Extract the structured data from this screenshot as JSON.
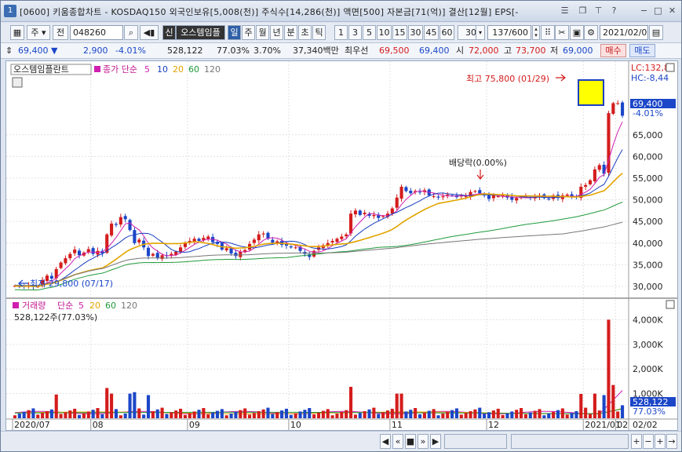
{
  "window": {
    "badge": "1",
    "title": "[0600] 키움종합차트 - KOSDAQ150 외국인보유[5,008(천)] 주식수[14,286(천)] 액면[500] 자본금[71(억)] 결산[12월] EPS[-"
  },
  "toolbar": {
    "type_label": "주",
    "prev_label": "전",
    "code": "048260",
    "badge_new": "신",
    "stock_name": "오스템임플",
    "periods": [
      "일",
      "주",
      "월",
      "년",
      "분",
      "초",
      "틱"
    ],
    "active_period": "일",
    "intervals": [
      "1",
      "3",
      "5",
      "10",
      "15",
      "30",
      "45",
      "60"
    ],
    "interval_value": "30",
    "count": "137/600",
    "date": "2021/02/02"
  },
  "info": {
    "price": "69,400",
    "change": "2,900",
    "change_pct": "-4.01%",
    "volume": "528,122",
    "volume_ratio": "77.03%",
    "turnover": "3.70%",
    "amount": "37,340백만",
    "best_ask_label": "최우선",
    "best_ask": "69,500",
    "best_bid": "69,400",
    "open_label": "시",
    "open": "72,000",
    "high_label": "고",
    "high": "73,700",
    "low_label": "저",
    "low": "69,000",
    "buy_label": "매수",
    "sell_label": "매도"
  },
  "price_panel": {
    "stock_tag": "오스템임플란트",
    "legend_prefix": "종가 단순",
    "ma": [
      {
        "label": "5",
        "color": "#d01fb0"
      },
      {
        "label": "10",
        "color": "#1a3fc0"
      },
      {
        "label": "20",
        "color": "#e3a400"
      },
      {
        "label": "60",
        "color": "#1f9a3b"
      },
      {
        "label": "120",
        "color": "#777777"
      }
    ],
    "limit_up": "LC:132,89",
    "limit_dn": "HC:-8,44",
    "current_price": "69,400",
    "current_pct": "-4.01%",
    "high_annot": "최고 75,800 (01/29)",
    "low_annot": "최저 29,800 (07/17)",
    "dividend_annot": "배당락(0.00%)",
    "y_ticks": [
      "65,000",
      "60,000",
      "55,000",
      "50,000",
      "45,000",
      "40,000",
      "35,000",
      "30,000"
    ]
  },
  "volume_panel": {
    "title": "거래량",
    "legend_prefix": "단순",
    "ma": [
      {
        "label": "5",
        "color": "#d01fb0"
      },
      {
        "label": "20",
        "color": "#e3a400"
      },
      {
        "label": "60",
        "color": "#1f9a3b"
      },
      {
        "label": "120",
        "color": "#777777"
      }
    ],
    "value_line": "528,122주(77.03%)",
    "y_ticks": [
      "4,000K",
      "3,000K",
      "2,000K",
      "1,000K"
    ],
    "current_volume": "528,122",
    "current_pct": "77.03%"
  },
  "x_axis": {
    "labels": [
      "2020/07",
      "08",
      "09",
      "10",
      "11",
      "12",
      "2021/01",
      "02"
    ],
    "right_label": "02/02"
  },
  "colors": {
    "up": "#d41c1c",
    "down": "#1b46c8",
    "accent": "#2e5fa6"
  },
  "chart_data": {
    "type": "candlestick",
    "price_range": [
      28000,
      78000
    ],
    "volume_range": [
      0,
      4300000
    ],
    "series": [
      {
        "name": "종가",
        "close": [
          30100,
          30000,
          29900,
          30200,
          29900,
          30000,
          31500,
          32500,
          31800,
          34000,
          35500,
          36500,
          37500,
          38500,
          37200,
          37800,
          38600,
          37500,
          38200,
          37600,
          42000,
          44500,
          44200,
          46000,
          45500,
          43000,
          40000,
          40800,
          39000,
          37000,
          37500,
          36500,
          37200,
          37000,
          37500,
          38000,
          39000,
          40000,
          40500,
          41000,
          40500,
          41200,
          41500,
          40200,
          39800,
          38500,
          38800,
          37600,
          37000,
          38000,
          38400,
          39800,
          40800,
          42000,
          42200,
          41000,
          40100,
          40400,
          39600,
          39400,
          39000,
          39000,
          38200,
          37500,
          36800,
          38200,
          39000,
          39500,
          40000,
          40500,
          41000,
          41500,
          42000,
          46800,
          47500,
          46500,
          47000,
          46300,
          46500,
          45800,
          46200,
          46800,
          48000,
          50500,
          53000,
          52000,
          51500,
          52000,
          51800,
          52200,
          51000,
          50800,
          50500,
          50800,
          51200,
          51000,
          50600,
          51000,
          50800,
          51800,
          52000,
          51500,
          51000,
          50200,
          51000,
          50800,
          51000,
          50500,
          50000,
          50400,
          50600,
          50800,
          50400,
          50600,
          51000,
          50400,
          50200,
          51000,
          50400,
          51000,
          51200,
          50600,
          50600,
          53000,
          53400,
          54500,
          57000,
          58000,
          56000,
          70000,
          72300,
          72300,
          69400
        ]
      }
    ]
  }
}
